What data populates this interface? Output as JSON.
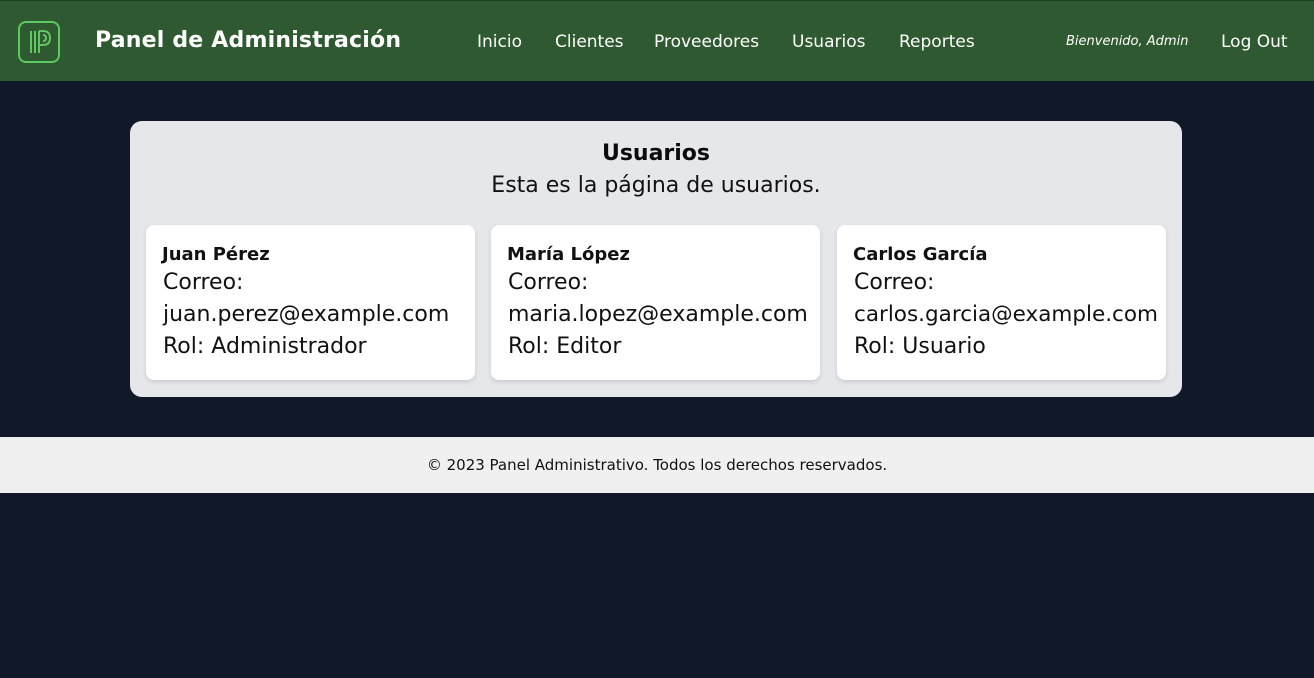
{
  "header": {
    "brand": "Panel de Administración",
    "nav": [
      {
        "label": "Inicio"
      },
      {
        "label": "Clientes"
      },
      {
        "label": "Proveedores"
      },
      {
        "label": "Usuarios"
      },
      {
        "label": "Reportes"
      }
    ],
    "welcome": "Bienvenido, Admin",
    "logout": "Log Out",
    "colors": {
      "background": "#2f5a31",
      "logo_accent": "#5cc85f"
    },
    "logo_icon": "panel-logo-icon"
  },
  "main": {
    "title": "Usuarios",
    "subtitle": "Esta es la página de usuarios.",
    "users": [
      {
        "name": "Juan Pérez",
        "email_label": "Correo:",
        "email": "juan.perez@example.com",
        "role": "Rol: Administrador"
      },
      {
        "name": "María López",
        "email_label": "Correo:",
        "email": "maria.lopez@example.com",
        "role": "Rol: Editor"
      },
      {
        "name": "Carlos García",
        "email_label": "Correo:",
        "email": "carlos.garcia@example.com",
        "role": "Rol: Usuario"
      }
    ]
  },
  "footer": {
    "text": "© 2023 Panel Administrativo. Todos los derechos reservados."
  }
}
